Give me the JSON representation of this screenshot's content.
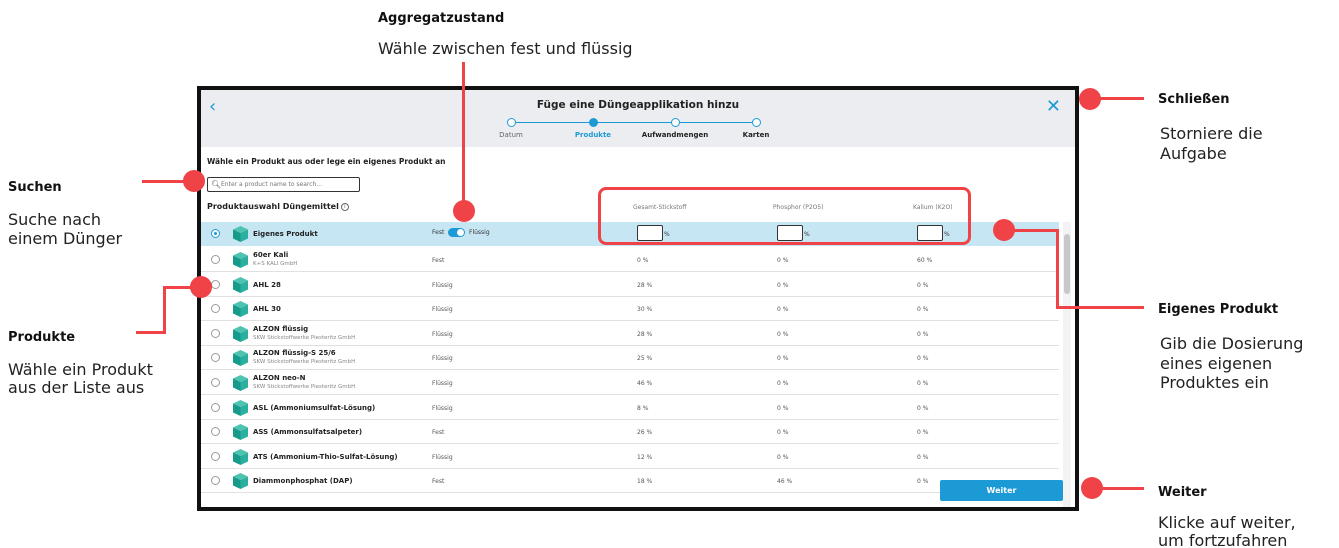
{
  "annotations": {
    "aggregatzustand": {
      "title": "Aggregatzustand",
      "desc": "Wähle zwischen fest und flüssig"
    },
    "schliessen": {
      "title": "Schließen",
      "desc_1": "Storniere die",
      "desc_2": "Aufgabe"
    },
    "suchen": {
      "title": "Suchen",
      "desc_1": "Suche nach",
      "desc_2": "einem Dünger"
    },
    "produkte": {
      "title": "Produkte",
      "desc_1": "Wähle ein Produkt",
      "desc_2": "aus der Liste aus"
    },
    "eigenes_produkt": {
      "title": "Eigenes Produkt",
      "desc_1": "Gib die Dosierung",
      "desc_2": "eines eigenen",
      "desc_3": "Produktes ein"
    },
    "weiter": {
      "title": "Weiter",
      "desc_1": "Klicke auf weiter,",
      "desc_2": "um fortzufahren"
    }
  },
  "dialog": {
    "title": "Füge eine Düngeapplikation hinzu",
    "back_icon": "‹",
    "close_icon": "✕",
    "steps": [
      {
        "label": "Datum",
        "state": "done"
      },
      {
        "label": "Produkte",
        "state": "active"
      },
      {
        "label": "Aufwandmengen",
        "state": "pending"
      },
      {
        "label": "Karten",
        "state": "pending"
      }
    ],
    "prompt": "Wähle ein Produkt aus oder lege ein eigenes Produkt an",
    "search_placeholder": "Enter a product name to search...",
    "list_title": "Produktauswahl Düngemittel",
    "info_icon": "i",
    "columns": [
      "Gesamt-Stickstoff",
      "Phosphor (P2O5)",
      "Kalium (K2O)"
    ],
    "own_product": {
      "name": "Eigenes Produkt",
      "toggle_left": "Fest",
      "toggle_right": "Flüssig",
      "toggle_value": "Flüssig",
      "unit": "%"
    },
    "products": [
      {
        "name": "60er Kali",
        "sub": "K+S KALI GmbH",
        "state": "Fest",
        "n": "0 %",
        "p": "0 %",
        "k": "60 %"
      },
      {
        "name": "AHL 28",
        "sub": "",
        "state": "Flüssig",
        "n": "28 %",
        "p": "0 %",
        "k": "0 %"
      },
      {
        "name": "AHL 30",
        "sub": "",
        "state": "Flüssig",
        "n": "30 %",
        "p": "0 %",
        "k": "0 %"
      },
      {
        "name": "ALZON flüssig",
        "sub": "SKW Stickstoffwerke Piesteritz GmbH",
        "state": "Flüssig",
        "n": "28 %",
        "p": "0 %",
        "k": "0 %"
      },
      {
        "name": "ALZON flüssig-S 25/6",
        "sub": "SKW Stickstoffwerke Piesteritz GmbH",
        "state": "Flüssig",
        "n": "25 %",
        "p": "0 %",
        "k": "0 %"
      },
      {
        "name": "ALZON neo-N",
        "sub": "SKW Stickstoffwerke Piesteritz GmbH",
        "state": "Flüssig",
        "n": "46 %",
        "p": "0 %",
        "k": "0 %"
      },
      {
        "name": "ASL (Ammoniumsulfat-Lösung)",
        "sub": "",
        "state": "Flüssig",
        "n": "8 %",
        "p": "0 %",
        "k": "0 %"
      },
      {
        "name": "ASS (Ammonsulfatsalpeter)",
        "sub": "",
        "state": "Fest",
        "n": "26 %",
        "p": "0 %",
        "k": "0 %"
      },
      {
        "name": "ATS (Ammonium-Thio-Sulfat-Lösung)",
        "sub": "",
        "state": "Flüssig",
        "n": "12 %",
        "p": "0 %",
        "k": "0 %"
      },
      {
        "name": "Diammonphosphat (DAP)",
        "sub": "",
        "state": "Fest",
        "n": "18 %",
        "p": "46 %",
        "k": "0 %"
      }
    ],
    "next_button": "Weiter"
  },
  "colors": {
    "accent": "#1c9ad6",
    "annotation_red": "#ef4348",
    "selected_row": "#c7e6f4",
    "header_bg": "#ecedf0"
  }
}
